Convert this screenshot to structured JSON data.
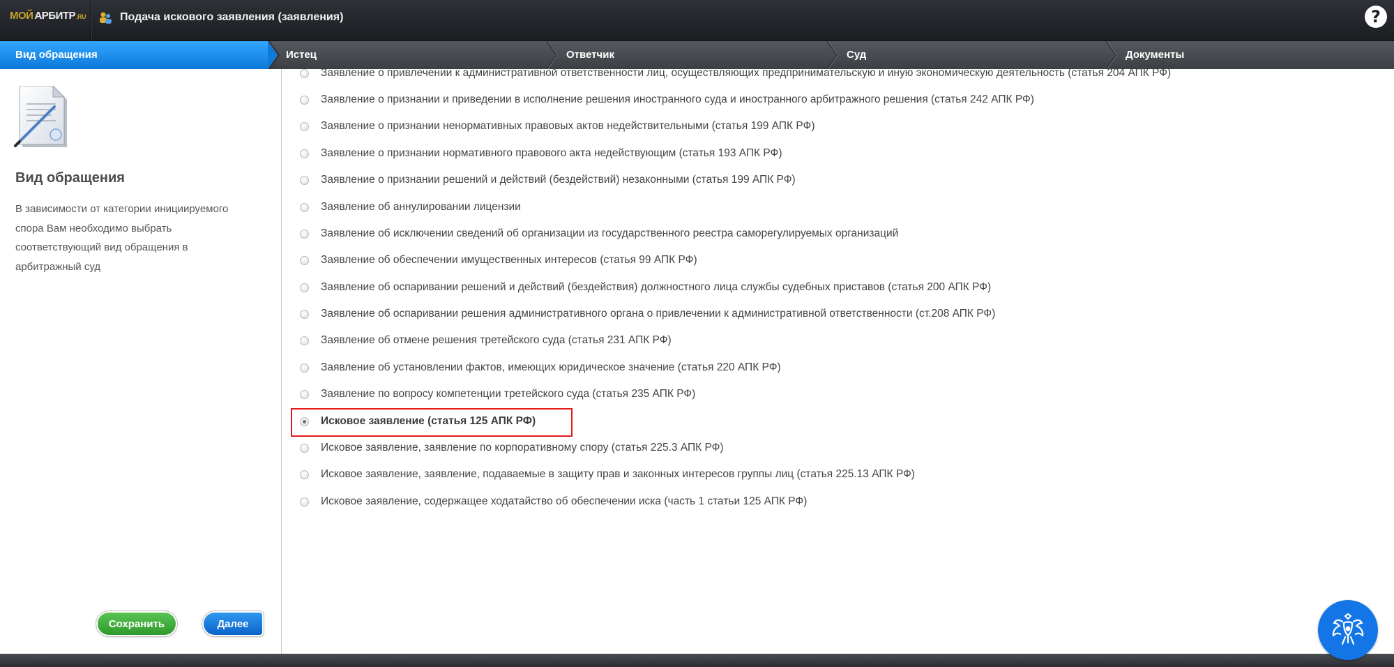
{
  "header": {
    "logo_part1": "МОЙ",
    "logo_part2": "АРБИТР",
    "logo_part3": ".RU",
    "title": "Подача искового заявления (заявления)",
    "help_label": "?"
  },
  "steps": [
    {
      "label": "Вид обращения",
      "active": true
    },
    {
      "label": "Истец",
      "active": false
    },
    {
      "label": "Ответчик",
      "active": false
    },
    {
      "label": "Суд",
      "active": false
    },
    {
      "label": "Документы",
      "active": false
    }
  ],
  "left_panel": {
    "title": "Вид обращения",
    "description": "В зависимости от категории инициируемого спора Вам необходимо выбрать соответствующий вид обращения в арбитражный суд",
    "save_label": "Сохранить",
    "next_label": "Далее"
  },
  "options": [
    {
      "label": "Заявление о привлечении к административной ответственности лиц, осуществляющих предпринимательскую и иную экономическую деятельность (статья 204 АПК РФ)",
      "checked": false
    },
    {
      "label": "Заявление о признании и приведении в исполнение решения иностранного суда и иностранного арбитражного решения (статья 242 АПК РФ)",
      "checked": false
    },
    {
      "label": "Заявление о признании ненормативных правовых актов недействительными (статья 199 АПК РФ)",
      "checked": false
    },
    {
      "label": "Заявление о признании нормативного правового акта недействующим (статья 193 АПК РФ)",
      "checked": false
    },
    {
      "label": "Заявление о признании решений и действий (бездействий) незаконными (статья 199 АПК РФ)",
      "checked": false
    },
    {
      "label": "Заявление об аннулировании лицензии",
      "checked": false
    },
    {
      "label": "Заявление об исключении сведений об организации из государственного реестра саморегулируемых организаций",
      "checked": false
    },
    {
      "label": "Заявление об обеспечении имущественных интересов (статья 99 АПК РФ)",
      "checked": false
    },
    {
      "label": "Заявление об оспаривании решений и действий (бездействия) должностного лица службы судебных приставов (статья 200 АПК РФ)",
      "checked": false
    },
    {
      "label": "Заявление об оспаривании решения административного органа о привлечении к административной ответственности (ст.208 АПК РФ)",
      "checked": false
    },
    {
      "label": "Заявление об отмене решения третейского суда (статья 231 АПК РФ)",
      "checked": false
    },
    {
      "label": "Заявление об установлении фактов, имеющих юридическое значение (статья 220 АПК РФ)",
      "checked": false
    },
    {
      "label": "Заявление по вопросу компетенции третейского суда (статья 235 АПК РФ)",
      "checked": false
    },
    {
      "label": "Исковое заявление (статья 125 АПК РФ)",
      "checked": true
    },
    {
      "label": "Исковое заявление, заявление по корпоративному спору (статья 225.3 АПК РФ)",
      "checked": false
    },
    {
      "label": "Исковое заявление, заявление, подаваемые в защиту прав и законных интересов группы лиц (статья 225.13 АПК РФ)",
      "checked": false
    },
    {
      "label": "Исковое заявление, содержащее ходатайство об обеспечении иска (часть 1 статьи 125 АПК РФ)",
      "checked": false
    }
  ],
  "colors": {
    "active_step": "#1a8ef0",
    "highlight": "#e31b1b",
    "save_button": "#3fae3b",
    "next_button": "#1577de"
  }
}
